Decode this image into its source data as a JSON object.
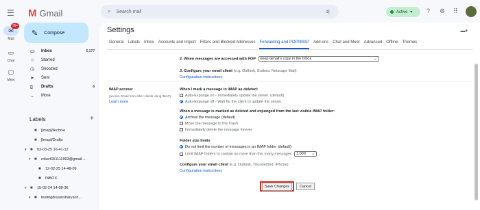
{
  "rail": {
    "menu_icon": "☰",
    "items": [
      {
        "label": "Mail",
        "icon": "✉",
        "badge": "99+"
      },
      {
        "label": "Chat",
        "icon": "▭"
      },
      {
        "label": "Meet",
        "icon": "▢"
      }
    ]
  },
  "app": {
    "name": "Gmail",
    "logo_glyph": "M"
  },
  "search": {
    "placeholder": "Search mail",
    "icon": "search-icon",
    "glyph": "⌕",
    "tune_glyph": "⚟"
  },
  "status": {
    "label": "Active",
    "caret": "▾"
  },
  "topbar": {
    "help_glyph": "?",
    "settings_glyph": "⚙",
    "apps_glyph": "⠿"
  },
  "compose": {
    "label": "Compose",
    "glyph": "✎"
  },
  "nav": [
    {
      "label": "Inbox",
      "count": "5,177",
      "icon": "▭"
    },
    {
      "label": "Starred",
      "count": "",
      "icon": "☆"
    },
    {
      "label": "Snoozed",
      "count": "",
      "icon": "◷"
    },
    {
      "label": "Sent",
      "count": "",
      "icon": "➤"
    },
    {
      "label": "Drafts",
      "count": "6",
      "icon": "▯"
    },
    {
      "label": "More",
      "count": "",
      "icon": "⌄"
    }
  ],
  "labels": {
    "heading": "Labels",
    "plus": "+",
    "items": [
      {
        "label": "[Imap]/Archive"
      },
      {
        "label": "[Imap]/Drafts"
      },
      {
        "label": "03-03-25 16-41-12"
      },
      {
        "label": "robert151111993@gmail-..."
      },
      {
        "label": "12-02-25 14-48-09"
      },
      {
        "label": "INBOX"
      },
      {
        "label": "15-02-24 14-08-36"
      },
      {
        "label": "testingdivyansharyson..."
      }
    ]
  },
  "settings": {
    "title": "Settings",
    "keyboard_glyph": "▬▾",
    "tabs": [
      "General",
      "Labels",
      "Inbox",
      "Accounts and Import",
      "Filters and Blocked Addresses",
      "Forwarding and POP/IMAP",
      "Add-ons",
      "Chat and Meet",
      "Advanced",
      "Offline",
      "Themes"
    ],
    "active_tab": "Forwarding and POP/IMAP",
    "pop": {
      "step2_label": "2. When messages are accessed with POP",
      "step2_value": "keep Gmail's copy in the Inbox",
      "step3_label": "3. Configure your email client",
      "step3_hint": "(e.g. Outlook, Eudora, Netscape Mail)",
      "step3_link": "Configuration instructions"
    },
    "imap": {
      "heading": "IMAP access:",
      "desc": "(access Gmail from other clients using IMAP)",
      "learn_more": "Learn more",
      "deleted_heading": "When I mark a message in IMAP as deleted:",
      "deleted_options": [
        {
          "label": "Auto-Expunge on - Immediately update the server. (default)",
          "selected": false
        },
        {
          "label": "Auto-Expunge off - Wait for the client to update the server.",
          "selected": true
        }
      ],
      "expunged_heading": "When a message is marked as deleted and expunged from the last visible IMAP folder:",
      "expunged_options": [
        {
          "label": "Archive the message (default)",
          "selected": true
        },
        {
          "label": "Move the message to the Trash",
          "selected": false
        },
        {
          "label": "Immediately delete the message forever",
          "selected": false
        }
      ],
      "folder_heading": "Folder size limits",
      "folder_opt1": "Do not limit the number of messages in an IMAP folder (default)",
      "folder_opt2": "Limit IMAP folders to contain no more than this many messages",
      "folder_limit": "1,000",
      "client_label": "Configure your email client",
      "client_hint": "(e.g. Outlook, Thunderbird, iPhone)",
      "client_link": "Configuration instructions"
    },
    "save_label": "Save Changes",
    "cancel_label": "Cancel"
  },
  "colors": {
    "accent": "#0b57d0",
    "highlight": "#d93025",
    "compose_bg": "#c2e7ff"
  }
}
